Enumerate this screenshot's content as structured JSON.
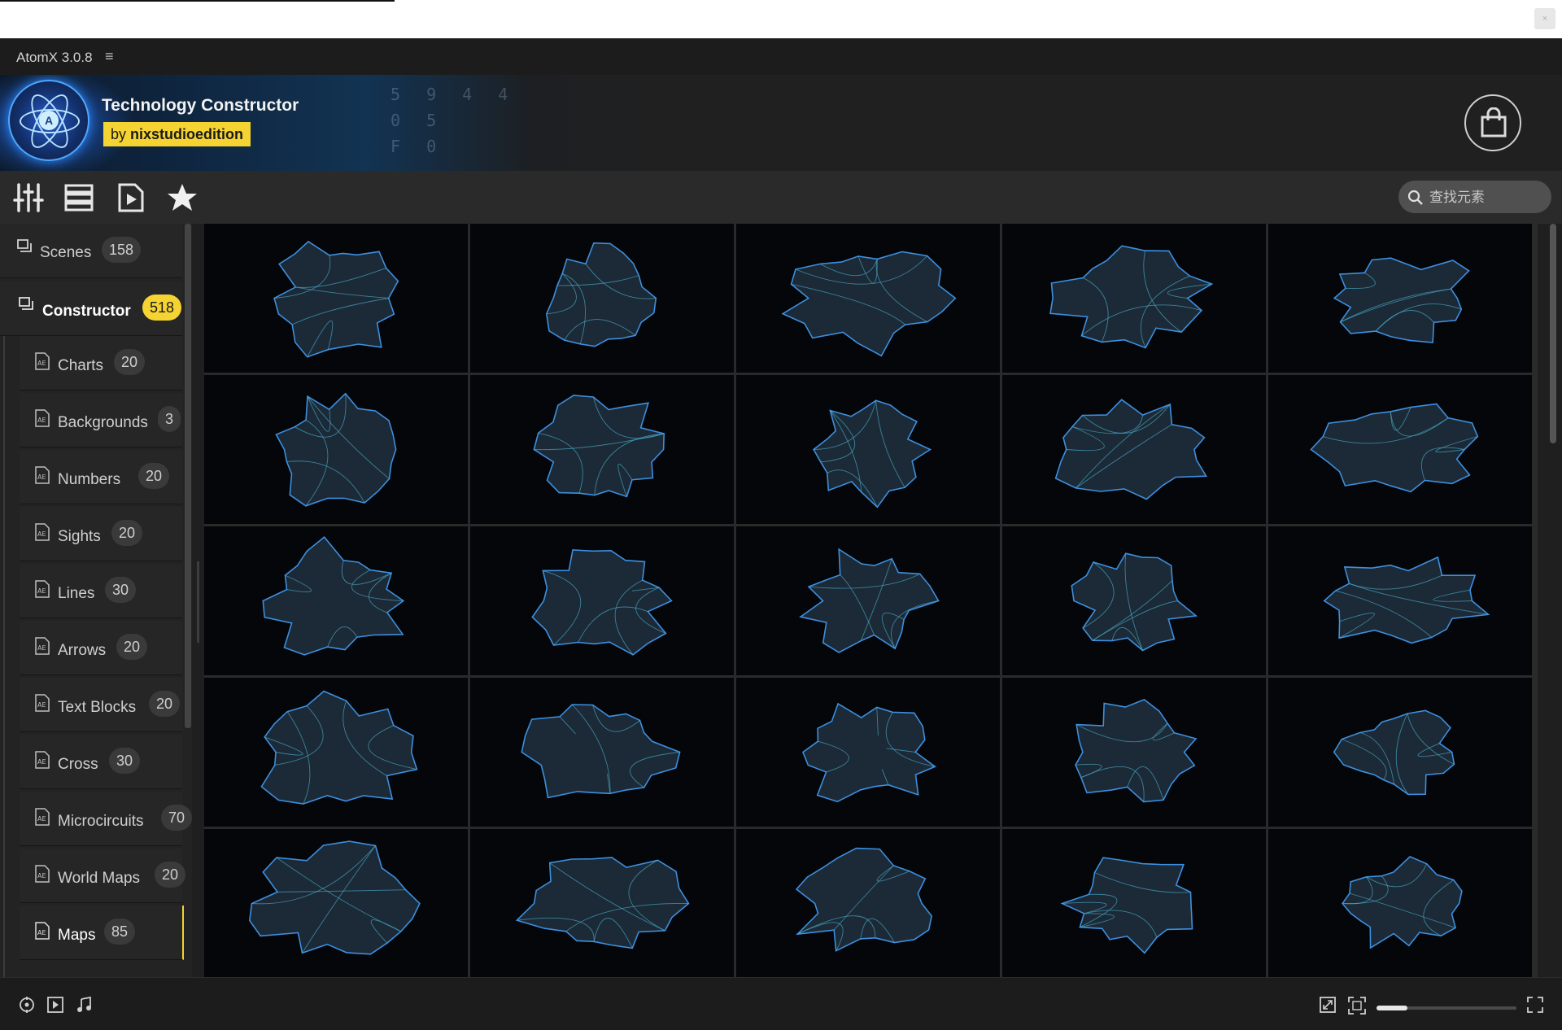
{
  "window": {
    "close_glyph": "×"
  },
  "app": {
    "title": "AtomX 3.0.8",
    "menu_icon": "≡"
  },
  "banner": {
    "package_title": "Technology Constructor",
    "author_prefix": "by",
    "author_name": "nixstudioedition",
    "bg_digits": [
      "5  9     4  4",
      "0  5",
      "F  0"
    ],
    "logo_letter": "A"
  },
  "toolbar": {
    "tools": [
      "settings-sliders-icon",
      "list-view-icon",
      "preview-play-icon",
      "favorites-star-icon"
    ],
    "search_placeholder": "查找元素"
  },
  "sidebar": {
    "top_items": [
      {
        "label": "Scenes",
        "count": "158"
      },
      {
        "label": "Constructor",
        "count": "518"
      }
    ],
    "sub_items": [
      {
        "label": "Charts",
        "count": "20"
      },
      {
        "label": "Backgrounds",
        "count": "3"
      },
      {
        "label": "Numbers",
        "count": "20"
      },
      {
        "label": "Sights",
        "count": "20"
      },
      {
        "label": "Lines",
        "count": "30"
      },
      {
        "label": "Arrows",
        "count": "20"
      },
      {
        "label": "Text Blocks",
        "count": "20"
      },
      {
        "label": "Cross",
        "count": "30"
      },
      {
        "label": "Microcircuits",
        "count": "70"
      },
      {
        "label": "World Maps",
        "count": "20"
      },
      {
        "label": "Maps",
        "count": "85"
      }
    ],
    "selected": "Maps"
  },
  "grid": {
    "thumbnails": [
      "africa-map",
      "algeria-map",
      "armenia-map",
      "asia-pacific-map",
      "australia-map",
      "austria-map",
      "azerbaijan-map",
      "bahrain-map",
      "belarus-map",
      "belgium-map",
      "bosnia-map",
      "brazil-map",
      "bulgaria-map",
      "canada-map",
      "china-map",
      "croatia-map",
      "czech-map",
      "denmark-map",
      "egypt-map",
      "estonia-map",
      "europe-map",
      "finland-map",
      "france-map",
      "georgia-map",
      "germany-map"
    ]
  },
  "statusbar": {
    "left_icons": [
      "gamepad-icon",
      "play-box-icon",
      "music-note-icon"
    ],
    "right_icons": [
      "fit-icon",
      "fullscreen-icon",
      "expand-icon"
    ],
    "zoom_fraction": 0.22
  },
  "colors": {
    "accent": "#f5d332",
    "map_fill": "#1b2a36",
    "map_stroke": "#3d8fe0",
    "map_inner": "#4aa8c8"
  }
}
